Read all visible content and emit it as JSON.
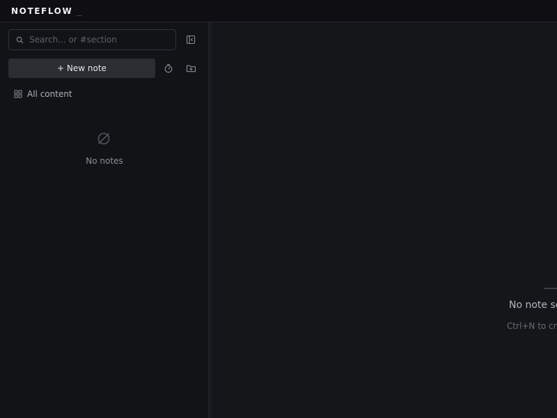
{
  "app": {
    "title": "NOTEFLOW",
    "cursor": "_"
  },
  "sidebar": {
    "search": {
      "placeholder": "Search... or #section",
      "value": ""
    },
    "new_note_label": "+ New note",
    "all_content_label": "All content",
    "empty_label": "No notes"
  },
  "main": {
    "empty_title": "No note selected",
    "empty_hint": "Ctrl+N to create"
  },
  "icons": {
    "search": "search-icon",
    "collapse": "sidebar-collapse-icon",
    "timer": "timer-icon",
    "new_folder": "folder-plus-icon",
    "grid": "grid-icon",
    "empty": "empty-set-icon"
  },
  "colors": {
    "background": "#15161a",
    "sidebar": "#121317",
    "titlebar": "#0e0e13",
    "button": "#2c2d33"
  }
}
